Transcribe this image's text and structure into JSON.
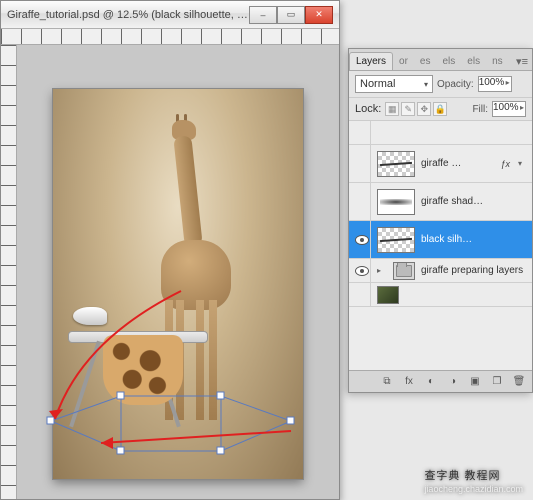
{
  "document": {
    "title": "Giraffe_tutorial.psd @ 12.5% (black silhouette, R…",
    "zoom": "12.5%",
    "filename": "Giraffe_tutorial.psd",
    "active_layer": "black silhouette"
  },
  "window_controls": {
    "minimize": "–",
    "maximize": "▭",
    "close": "✕"
  },
  "panel": {
    "tabs": [
      "Layers",
      "or",
      "es",
      "els",
      "els",
      "ns"
    ],
    "active_tab": 0,
    "menu_glyph": "▾≡",
    "blend_mode": "Normal",
    "opacity_label": "Opacity:",
    "opacity_value": "100%",
    "lock_label": "Lock:",
    "lock_icons": [
      "▦",
      "✎",
      "✥",
      "🔒"
    ],
    "fill_label": "Fill:",
    "fill_value": "100%",
    "layers": [
      {
        "visible": false,
        "thumb": "checker-stroke",
        "name": "giraffe …",
        "fx": true,
        "has_disclose": true
      },
      {
        "visible": false,
        "thumb": "soft-stroke",
        "name": "giraffe shad…",
        "fx": false,
        "has_disclose": false
      },
      {
        "visible": true,
        "thumb": "checker-stroke",
        "name": "black silh…",
        "fx": false,
        "selected": true
      },
      {
        "visible": true,
        "thumb": "folder",
        "name": "giraffe preparing layers",
        "fx": false,
        "is_group": true,
        "has_disclose": true
      },
      {
        "visible": false,
        "thumb": "image",
        "name": "",
        "slim": true
      }
    ],
    "footer_icons": {
      "link": "⧉",
      "fx": "fx",
      "mask": "◐",
      "adjust": "◑",
      "group": "▣",
      "new": "�ры",
      "trash": "🗑"
    }
  },
  "watermark": {
    "main": "查字典 教程网",
    "sub": "jiaocheng.chazidian.com"
  }
}
